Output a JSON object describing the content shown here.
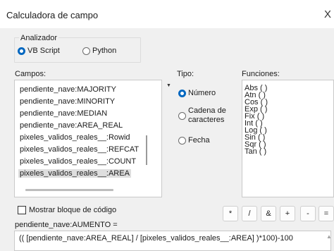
{
  "window": {
    "title": "Calculadora de campo",
    "close_label": "X"
  },
  "parser": {
    "label": "Analizador",
    "options": [
      {
        "label": "VB Script",
        "selected": true
      },
      {
        "label": "Python",
        "selected": false
      }
    ]
  },
  "fields": {
    "label": "Campos:",
    "items": [
      "pendiente_nave:MAJORITY",
      "pendiente_nave:MINORITY",
      "pendiente_nave:MEDIAN",
      "pendiente_nave:AREA_REAL",
      "pixeles_validos_reales__:Rowid",
      "pixeles_validos_reales__:REFCAT",
      "pixeles_validos_reales__:COUNT",
      "pixeles_validos_reales__:AREA"
    ],
    "selected_index": 7
  },
  "type": {
    "label": "Tipo:",
    "options": [
      {
        "label": "Número",
        "selected": true
      },
      {
        "label": "Cadena de caracteres",
        "line1": "Cadena de",
        "line2": "caracteres",
        "selected": false
      },
      {
        "label": "Fecha",
        "selected": false
      }
    ]
  },
  "functions": {
    "label": "Funciones:",
    "items": [
      "Abs ( )",
      "Atn ( )",
      "Cos ( )",
      "Exp ( )",
      "Fix ( )",
      "Int ( )",
      "Log ( )",
      "Sin ( )",
      "Sqr ( )",
      "Tan ( )"
    ]
  },
  "show_code_block": {
    "label": "Mostrar bloque de código",
    "checked": false
  },
  "operators": [
    "*",
    "/",
    "&",
    "+",
    "-",
    "="
  ],
  "target_field_label": "pendiente_nave:AUMENTO =",
  "expression": "(( [pendiente_nave:AREA_REAL] / [pixeles_validos_reales__:AREA] )*100)-100",
  "colors": {
    "accent": "#0067c0",
    "background": "#f0f0f0"
  }
}
